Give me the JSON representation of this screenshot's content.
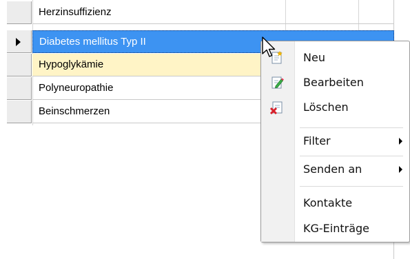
{
  "grid": {
    "rows": [
      {
        "text": "Herzinsuffizienz",
        "state": "normal"
      },
      {
        "text": "Diabetes mellitus Typ II",
        "state": "selected"
      },
      {
        "text": "Hypoglykämie",
        "state": "hover"
      },
      {
        "text": "Polyneuropathie",
        "state": "normal"
      },
      {
        "text": "Beinschmerzen",
        "state": "normal"
      }
    ]
  },
  "context_menu": {
    "items": [
      {
        "label": "Neu",
        "icon": "new-icon"
      },
      {
        "label": "Bearbeiten",
        "icon": "edit-icon"
      },
      {
        "label": "Löschen",
        "icon": "delete-icon"
      },
      {
        "label": "Filter",
        "submenu": true
      },
      {
        "label": "Senden an",
        "submenu": true
      },
      {
        "label": "Kontakte"
      },
      {
        "label": "KG-Einträge"
      }
    ]
  },
  "colors": {
    "selected_bg": "#3d93f2",
    "hover_bg": "#fff4c6"
  }
}
